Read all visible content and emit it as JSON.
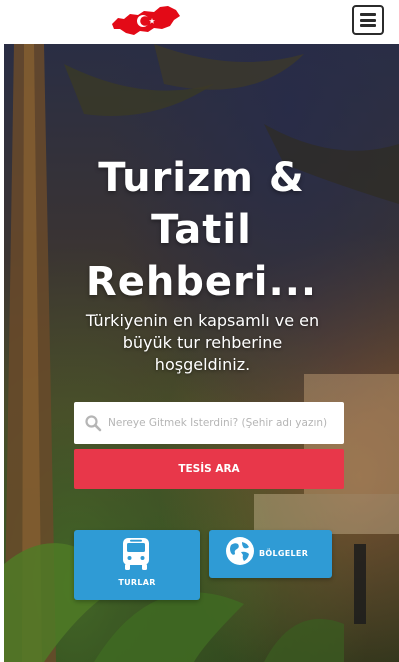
{
  "header": {
    "logo_icon": "turkey-flag-map-icon",
    "menu_icon": "hamburger-menu-icon"
  },
  "hero": {
    "title_line1": "Turizm &",
    "title_line2": "Tatil",
    "title_line3": "Rehberi...",
    "subtitle_line1": "Türkiyenin en kapsamlı ve en",
    "subtitle_line2": "büyük tur rehberine",
    "subtitle_line3": "hoşgeldiniz."
  },
  "search": {
    "placeholder": "Nereye Gitmek İsterdini? (Şehir adı yazın)",
    "icon": "search-icon",
    "button_label": "TESİS ARA"
  },
  "tiles": {
    "turlar": {
      "label": "TURLAR",
      "icon": "bus-icon"
    },
    "bolgeler": {
      "label": "BÖLGELER",
      "icon": "globe-icon"
    }
  },
  "colors": {
    "accent_red": "#e8374a",
    "tile_blue": "#2f9bd5",
    "flag_red": "#e30a17"
  }
}
